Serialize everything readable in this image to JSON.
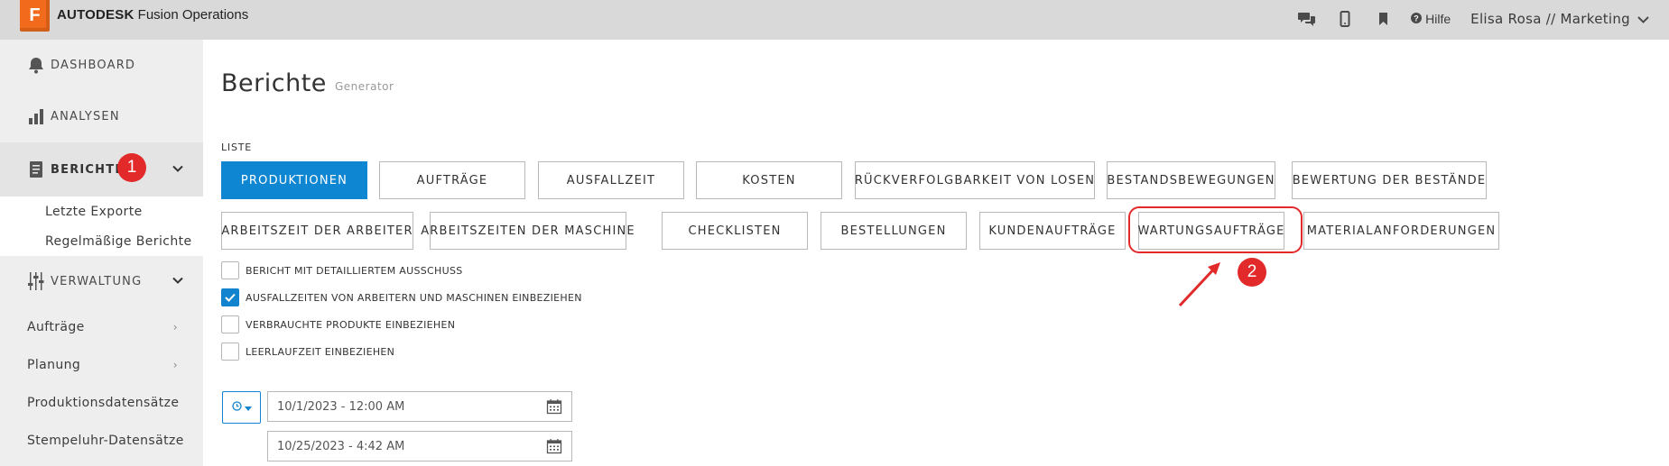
{
  "topbar": {
    "logo_letter": "F",
    "brand_bold": "AUTODESK",
    "brand_rest": " Fusion Operations",
    "help_label": "Hilfe",
    "user_label": "Elisa Rosa // Marketing",
    "icons": [
      "chat-icon",
      "mobile-icon",
      "bookmark-icon",
      "help-icon",
      "chevron-down-icon"
    ]
  },
  "sidebar": {
    "dashboard": "DASHBOARD",
    "analysen": "ANALYSEN",
    "berichte": "BERICHTE",
    "berichte_badge": "1",
    "berichte_sub": [
      "Letzte Exporte",
      "Regelmäßige Berichte"
    ],
    "verwaltung": "VERWALTUNG",
    "verwaltung_sub": [
      "Aufträge",
      "Planung",
      "Produktionsdatensätze",
      "Stempeluhr-Datensätze"
    ]
  },
  "main": {
    "title": "Berichte",
    "subtitle": "Generator",
    "list_label": "LISTE",
    "row1": [
      "PRODUKTIONEN",
      "AUFTRÄGE",
      "AUSFALLZEIT",
      "KOSTEN",
      "RÜCKVERFOLGBARKEIT VON LOSEN",
      "BESTANDSBEWEGUNGEN",
      "BEWERTUNG DER BESTÄNDE"
    ],
    "row2": [
      "ARBEITSZEIT DER ARBEITER",
      "ARBEITSZEITEN DER MASCHINE",
      "CHECKLISTEN",
      "BESTELLUNGEN",
      "KUNDENAUFTRÄGE",
      "WARTUNGSAUFTRÄGE",
      "MATERIALANFORDERUNGEN"
    ],
    "active_report": "PRODUKTIONEN",
    "checkboxes": [
      {
        "label": "BERICHT MIT DETAILLIERTEM AUSSCHUSS",
        "checked": false
      },
      {
        "label": "AUSFALLZEITEN VON ARBEITERN UND MASCHINEN EINBEZIEHEN",
        "checked": true
      },
      {
        "label": "VERBRAUCHTE PRODUKTE EINBEZIEHEN",
        "checked": false
      },
      {
        "label": "LEERLAUFZEIT EINBEZIEHEN",
        "checked": false
      }
    ],
    "date_from": "10/1/2023 - 12:00 AM",
    "date_to": "10/25/2023 - 4:42 AM",
    "annotation_badge": "2",
    "accent_color": "#0f86d1",
    "annotation_color": "#e22a2a"
  }
}
